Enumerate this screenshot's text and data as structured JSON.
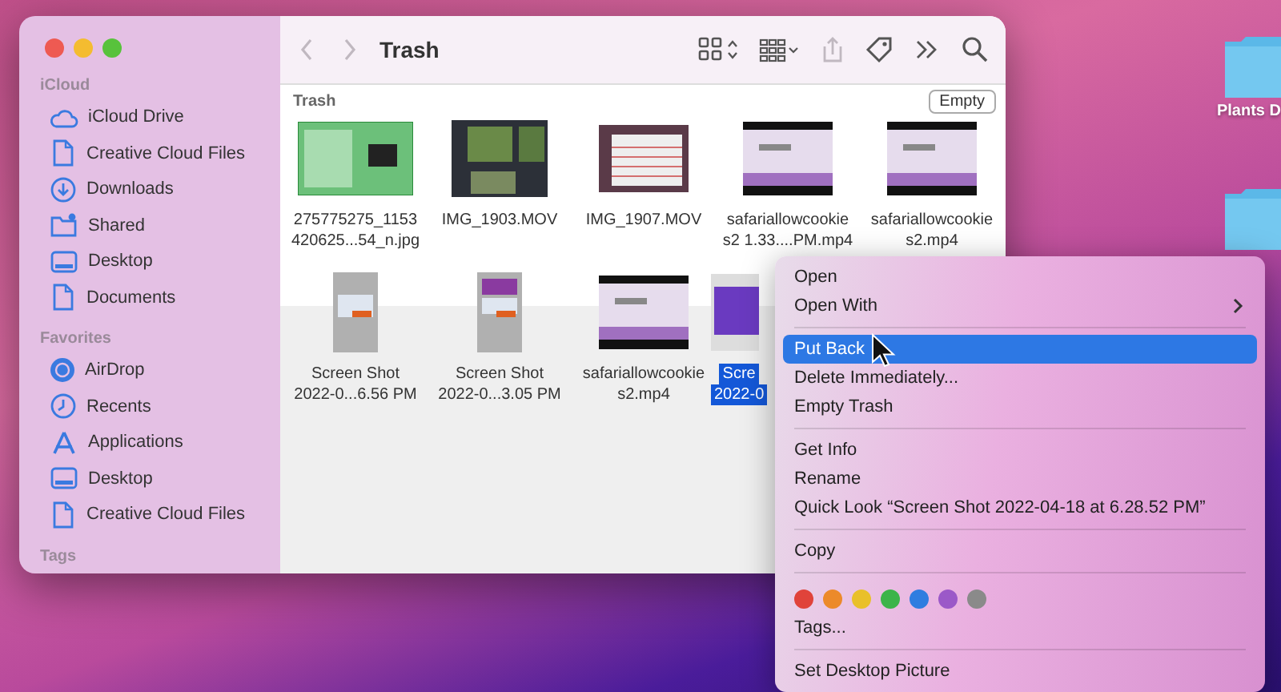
{
  "window": {
    "title": "Trash"
  },
  "toolbar": {
    "buttons": [
      {
        "kind": "back",
        "disabled": true
      },
      {
        "kind": "forward",
        "disabled": true
      },
      {
        "kind": "icons",
        "disabled": false
      },
      {
        "kind": "group",
        "disabled": false
      },
      {
        "kind": "share",
        "disabled": true
      },
      {
        "kind": "tag",
        "disabled": false
      },
      {
        "kind": "more",
        "disabled": false
      },
      {
        "kind": "search",
        "disabled": false
      }
    ]
  },
  "sidebar": {
    "sections": [
      {
        "heading": "iCloud",
        "items": [
          {
            "label": "iCloud Drive",
            "kind": "cloud",
            "selected": false
          },
          {
            "label": "Creative Cloud Files",
            "kind": "document",
            "selected": false
          },
          {
            "label": "Downloads",
            "kind": "download",
            "selected": false
          },
          {
            "label": "Shared",
            "kind": "shared",
            "selected": false
          },
          {
            "label": "Desktop",
            "kind": "desktop",
            "selected": false
          },
          {
            "label": "Documents",
            "kind": "document",
            "selected": false
          }
        ]
      },
      {
        "heading": "Favorites",
        "items": [
          {
            "label": "AirDrop",
            "kind": "airdrop",
            "selected": false
          },
          {
            "label": "Recents",
            "kind": "clock",
            "selected": false
          },
          {
            "label": "Applications",
            "kind": "apps",
            "selected": false
          },
          {
            "label": "Desktop",
            "kind": "desktop",
            "selected": false
          },
          {
            "label": "Creative Cloud Files",
            "kind": "document",
            "selected": false
          }
        ]
      },
      {
        "heading": "Tags"
      }
    ]
  },
  "content": {
    "path_label": "Trash",
    "empty_button": "Empty",
    "files": [
      {
        "lines": [
          "275775275_1153",
          "420625...54_n.jpg"
        ],
        "kind": "green",
        "selected": false
      },
      {
        "lines": [
          "IMG_1903.MOV"
        ],
        "kind": "video",
        "selected": false
      },
      {
        "lines": [
          "IMG_1907.MOV"
        ],
        "kind": "table",
        "selected": false
      },
      {
        "lines": [
          "safariallowcookie",
          "s2 1.33....PM.mp4"
        ],
        "kind": "screen",
        "selected": false
      },
      {
        "lines": [
          "safariallowcookie",
          "s2.mp4"
        ],
        "kind": "screen",
        "selected": false
      },
      {
        "lines": [
          "Screen Shot",
          "2022-0...6.56 PM"
        ],
        "kind": "portrait",
        "selected": false
      },
      {
        "lines": [
          "Screen Shot",
          "2022-0...3.05 PM"
        ],
        "kind": "portrait-purple",
        "selected": false
      },
      {
        "lines": [
          "safariallowcookie",
          "s2.mp4"
        ],
        "kind": "screen",
        "selected": false
      },
      {
        "lines": [
          "Scre",
          "2022-0"
        ],
        "kind": "desktop",
        "selected": true
      }
    ]
  },
  "context_menu": {
    "items": [
      {
        "kind": "item",
        "label": "Open",
        "submenu": false,
        "selected": false
      },
      {
        "kind": "item",
        "label": "Open With",
        "submenu": true,
        "selected": false
      },
      {
        "kind": "separator"
      },
      {
        "kind": "item",
        "label": "Put Back",
        "submenu": false,
        "selected": true
      },
      {
        "kind": "item",
        "label": "Delete Immediately...",
        "submenu": false,
        "selected": false
      },
      {
        "kind": "item",
        "label": "Empty Trash",
        "submenu": false,
        "selected": false
      },
      {
        "kind": "separator"
      },
      {
        "kind": "item",
        "label": "Get Info",
        "submenu": false,
        "selected": false
      },
      {
        "kind": "item",
        "label": "Rename",
        "submenu": false,
        "selected": false
      },
      {
        "kind": "item",
        "label": "Quick Look “Screen Shot 2022-04-18 at 6.28.52 PM”",
        "submenu": false,
        "selected": false
      },
      {
        "kind": "separator"
      },
      {
        "kind": "item",
        "label": "Copy",
        "submenu": false,
        "selected": false
      },
      {
        "kind": "separator"
      },
      {
        "kind": "colors",
        "colors": [
          {
            "color": "#e0433a"
          },
          {
            "color": "#ec8a2a"
          },
          {
            "color": "#e9c02a"
          },
          {
            "color": "#3cb44a"
          },
          {
            "color": "#2f7de0"
          },
          {
            "color": "#9b59c8"
          },
          {
            "color": "#8a8a8a"
          }
        ]
      },
      {
        "kind": "item",
        "label": "Tags...",
        "submenu": false,
        "selected": false
      },
      {
        "kind": "separator"
      },
      {
        "kind": "item",
        "label": "Set Desktop Picture",
        "submenu": false,
        "selected": false
      }
    ]
  },
  "desktop": {
    "items": [
      {
        "kind": "folder",
        "label": "Plants D"
      },
      {
        "kind": "folder"
      }
    ]
  }
}
